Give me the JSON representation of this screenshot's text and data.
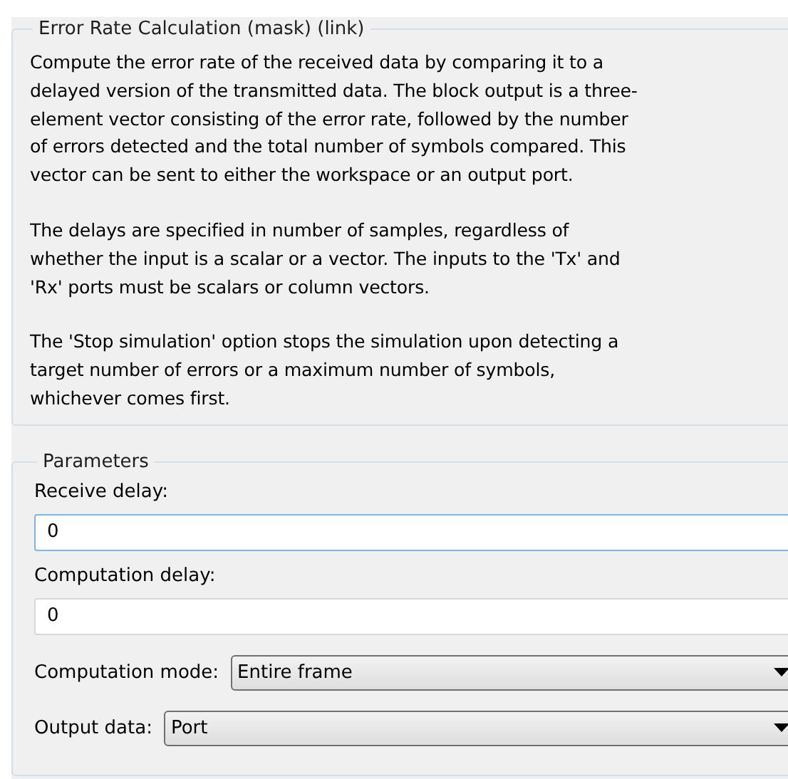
{
  "description_group": {
    "title": "Error Rate Calculation (mask) (link)",
    "paragraphs": [
      [
        "Compute the error rate of the received data by comparing it to a",
        "delayed version of the transmitted data. The block output is a three-",
        "element vector consisting of the error rate, followed by the number",
        "of errors detected and the total number of symbols compared. This",
        "vector can be sent to either the workspace or an output port."
      ],
      [
        "The delays are specified in number of samples, regardless of",
        "whether the input is a scalar or a vector. The inputs to the 'Tx' and",
        "'Rx' ports must be scalars or column vectors."
      ],
      [
        "The 'Stop simulation' option stops the simulation upon detecting a",
        "target number of errors or a maximum number of symbols,",
        "whichever comes first."
      ]
    ]
  },
  "parameters": {
    "title": "Parameters",
    "fields": [
      {
        "kind": "edit",
        "label": "Receive delay:",
        "value": "0",
        "focused": true
      },
      {
        "kind": "edit",
        "label": "Computation delay:",
        "value": "0",
        "focused": false
      },
      {
        "kind": "dropdown",
        "label": "Computation mode:",
        "value": "Entire frame"
      },
      {
        "kind": "dropdown",
        "label": "Output data:",
        "value": "Port"
      }
    ]
  }
}
